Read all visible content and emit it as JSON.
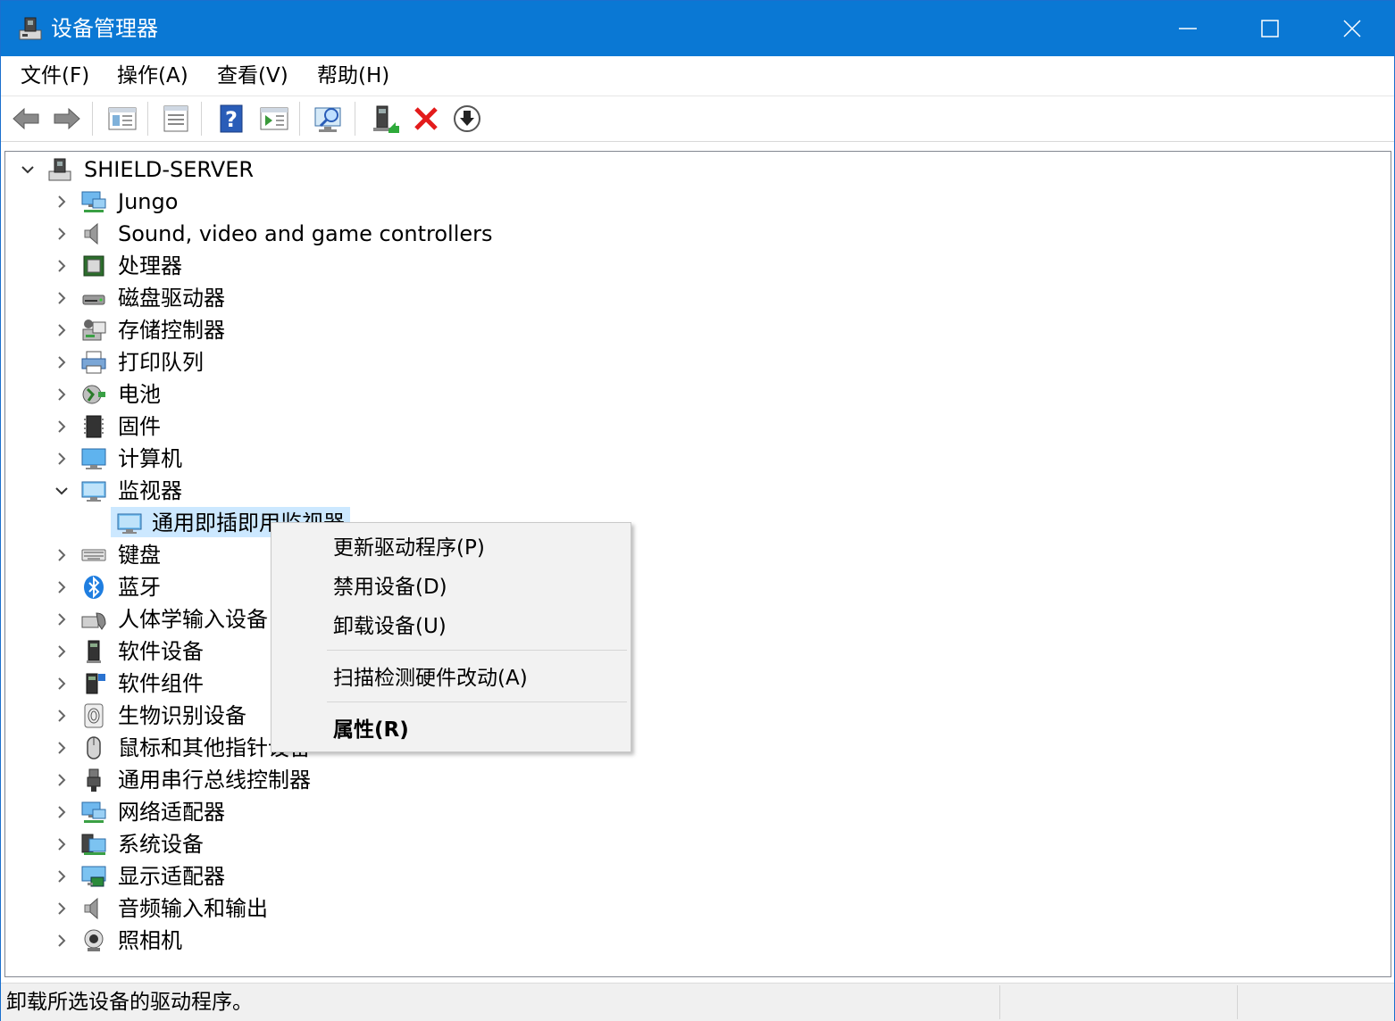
{
  "window": {
    "title": "设备管理器",
    "accent": "#0a78d4"
  },
  "menu": [
    {
      "label": "文件(F)"
    },
    {
      "label": "操作(A)"
    },
    {
      "label": "查看(V)"
    },
    {
      "label": "帮助(H)"
    }
  ],
  "toolbar": {
    "buttons": [
      "back-icon",
      "forward-icon",
      "show-hide-tree-icon",
      "properties-icon",
      "help-icon",
      "action-pane-icon",
      "scan-hardware-icon",
      "update-driver-icon",
      "uninstall-icon",
      "disable-icon"
    ]
  },
  "tree": {
    "root": "SHIELD-SERVER",
    "categories": [
      {
        "label": "Jungo",
        "icon": "network-icon"
      },
      {
        "label": "Sound, video and game controllers",
        "icon": "speaker-icon"
      },
      {
        "label": "处理器",
        "icon": "processor-icon"
      },
      {
        "label": "磁盘驱动器",
        "icon": "disk-drive-icon"
      },
      {
        "label": "存储控制器",
        "icon": "storage-controller-icon"
      },
      {
        "label": "打印队列",
        "icon": "printer-icon"
      },
      {
        "label": "电池",
        "icon": "battery-icon"
      },
      {
        "label": "固件",
        "icon": "firmware-icon"
      },
      {
        "label": "计算机",
        "icon": "computer-icon"
      },
      {
        "label": "监视器",
        "icon": "monitor-icon",
        "expanded": true
      },
      {
        "label": "通用即插即用监视器",
        "icon": "monitor-icon",
        "child": true,
        "selected": true
      },
      {
        "label": "键盘",
        "icon": "keyboard-icon"
      },
      {
        "label": "蓝牙",
        "icon": "bluetooth-icon"
      },
      {
        "label": "人体学输入设备",
        "icon": "hid-icon"
      },
      {
        "label": "软件设备",
        "icon": "software-device-icon"
      },
      {
        "label": "软件组件",
        "icon": "software-component-icon"
      },
      {
        "label": "生物识别设备",
        "icon": "fingerprint-icon"
      },
      {
        "label": "鼠标和其他指针设备",
        "icon": "mouse-icon"
      },
      {
        "label": "通用串行总线控制器",
        "icon": "usb-icon"
      },
      {
        "label": "网络适配器",
        "icon": "network-icon"
      },
      {
        "label": "系统设备",
        "icon": "system-device-icon"
      },
      {
        "label": "显示适配器",
        "icon": "display-adapter-icon"
      },
      {
        "label": "音频输入和输出",
        "icon": "speaker-icon"
      },
      {
        "label": "照相机",
        "icon": "camera-icon"
      }
    ]
  },
  "context_menu": {
    "items": [
      {
        "label": "更新驱动程序(P)"
      },
      {
        "label": "禁用设备(D)"
      },
      {
        "label": "卸载设备(U)"
      },
      {
        "label": "扫描检测硬件改动(A)"
      },
      {
        "label": "属性(R)",
        "bold": true
      }
    ]
  },
  "status": {
    "text": "卸载所选设备的驱动程序。"
  }
}
